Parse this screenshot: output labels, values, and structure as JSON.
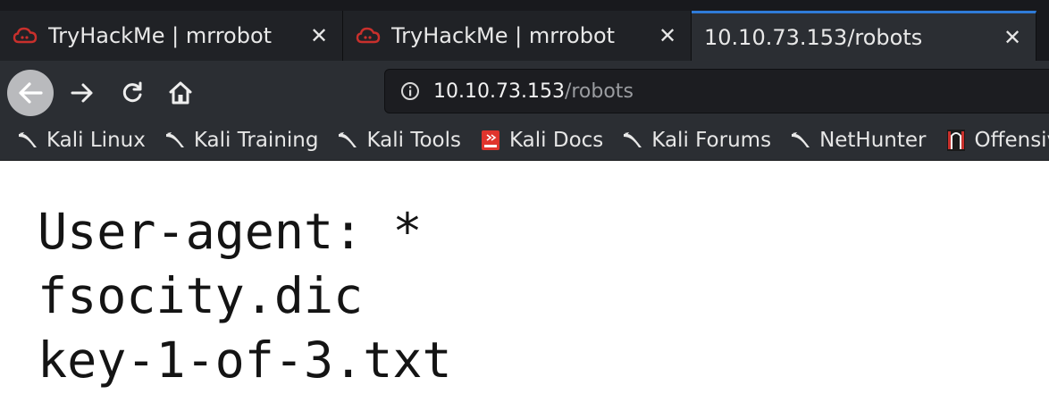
{
  "tabs": [
    {
      "title": "TryHackMe | mrrobot",
      "icon": "tryhackme-cloud-icon",
      "active": false
    },
    {
      "title": "TryHackMe | mrrobot",
      "icon": "tryhackme-cloud-icon",
      "active": false
    },
    {
      "title": "10.10.73.153/robots",
      "icon": "",
      "active": true
    }
  ],
  "nav": {
    "url_host": "10.10.73.153",
    "url_path": "/robots"
  },
  "bookmarks": [
    {
      "label": "Kali Linux",
      "icon": "kali-dragon-icon"
    },
    {
      "label": "Kali Training",
      "icon": "kali-dragon-icon"
    },
    {
      "label": "Kali Tools",
      "icon": "kali-dragon-icon"
    },
    {
      "label": "Kali Docs",
      "icon": "kali-docs-icon"
    },
    {
      "label": "Kali Forums",
      "icon": "kali-dragon-icon"
    },
    {
      "label": "NetHunter",
      "icon": "kali-dragon-icon"
    },
    {
      "label": "Offensive Security",
      "icon": "offsec-icon"
    }
  ],
  "page": {
    "lines": [
      "User-agent: *",
      "fsocity.dic",
      "key-1-of-3.txt"
    ]
  },
  "colors": {
    "accent": "#2f7bd8",
    "chrome_bg": "#2b2e33",
    "tabstrip_bg": "#18191d",
    "page_bg": "#ffffff"
  }
}
